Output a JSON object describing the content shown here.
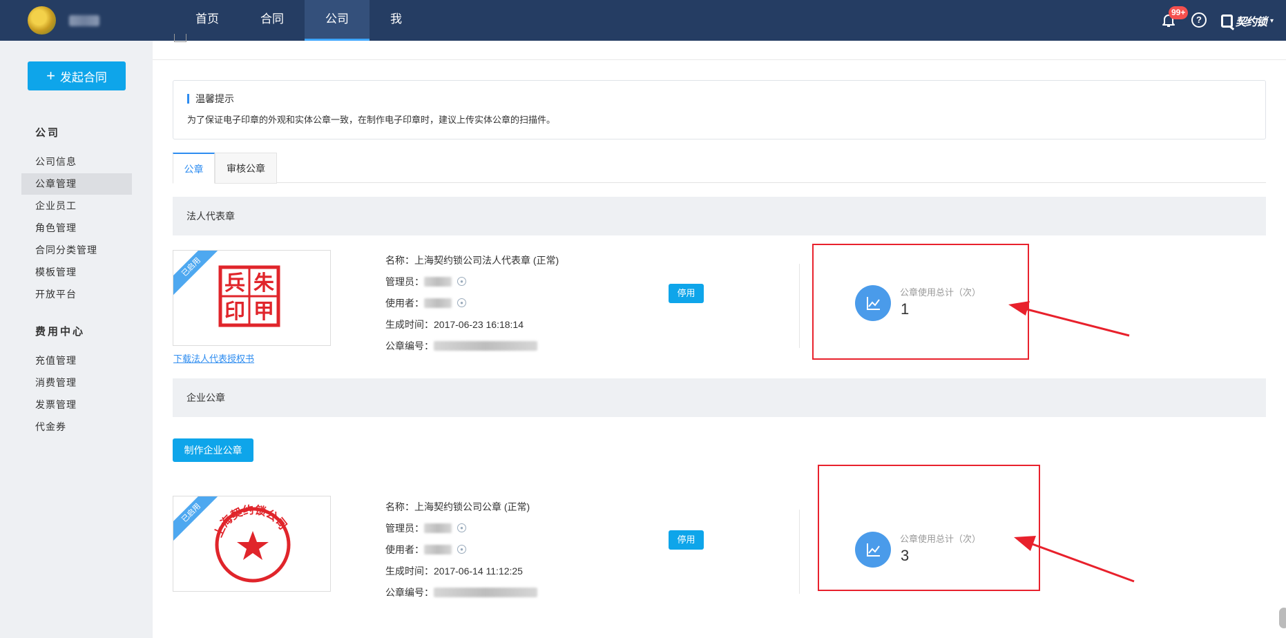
{
  "topbar": {
    "nav": [
      "首页",
      "合同",
      "公司",
      "我"
    ],
    "active_nav": "公司",
    "badge": "99+",
    "help_glyph": "?",
    "brand": "契约锁",
    "caret": "▾"
  },
  "sidebar": {
    "launch_label": "发起合同",
    "groups": [
      {
        "title": "公司",
        "items": [
          "公司信息",
          "公章管理",
          "企业员工",
          "角色管理",
          "合同分类管理",
          "模板管理",
          "开放平台"
        ]
      },
      {
        "title": "费用中心",
        "items": [
          "充值管理",
          "消费管理",
          "发票管理",
          "代金券"
        ]
      }
    ],
    "active_item": "公章管理"
  },
  "tip": {
    "title": "温馨提示",
    "text": "为了保证电子印章的外观和实体公章一致，在制作电子印章时，建议上传实体公章的扫描件。"
  },
  "tabs": [
    "公章",
    "审核公章"
  ],
  "sections": {
    "legal": "法人代表章",
    "company": "企业公章"
  },
  "make_button": "制作企业公章",
  "seals": [
    {
      "ribbon": "已启用",
      "seal_text": [
        "兵",
        "朱",
        "印",
        "甲"
      ],
      "name_label": "名称：",
      "name": "上海契约锁公司法人代表章 (正常)",
      "manager_label": "管理员：",
      "user_label": "使用者：",
      "created_label": "生成时间：",
      "created": "2017-06-23 16:18:14",
      "code_label": "公章编号：",
      "stop_label": "停用",
      "stat_label": "公章使用总计（次）",
      "stat_value": "1",
      "download_link": "下载法人代表授权书"
    },
    {
      "ribbon": "已启用",
      "seal_text": "上海契约锁公司",
      "name_label": "名称：",
      "name": "上海契约锁公司公章 (正常)",
      "manager_label": "管理员：",
      "user_label": "使用者：",
      "created_label": "生成时间：",
      "created": "2017-06-14 11:12:25",
      "code_label": "公章编号：",
      "stop_label": "停用",
      "stat_label": "公章使用总计（次）",
      "stat_value": "3"
    }
  ],
  "colors": {
    "topbar": "#253d63",
    "accent": "#0ea5ea",
    "annotation": "#e8212c",
    "seal_red": "#e0252b"
  }
}
